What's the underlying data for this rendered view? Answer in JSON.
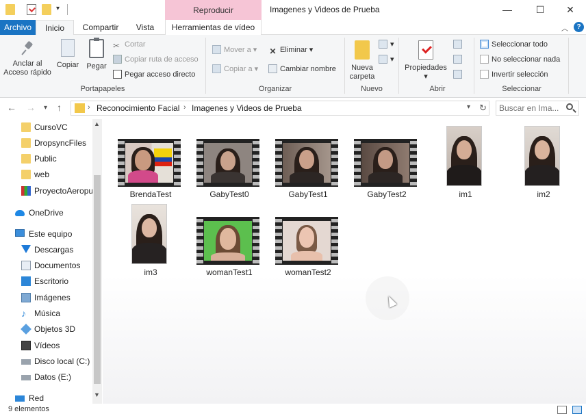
{
  "window": {
    "title": "Imagenes y Videos de Prueba",
    "context_tab_header": "Reproducir",
    "minimize": "—",
    "maximize": "☐",
    "close": "✕"
  },
  "tabs": {
    "archivo": "Archivo",
    "inicio": "Inicio",
    "compartir": "Compartir",
    "vista": "Vista",
    "herramientas": "Herramientas de vídeo"
  },
  "ribbon": {
    "portapapeles": {
      "label": "Portapapeles",
      "anclar": "Anclar al",
      "anclar2": "Acceso rápido",
      "copiar": "Copiar",
      "pegar": "Pegar",
      "cortar": "Cortar",
      "copiar_ruta": "Copiar ruta de acceso",
      "pegar_acceso": "Pegar acceso directo"
    },
    "organizar": {
      "label": "Organizar",
      "mover": "Mover a",
      "copiar_a": "Copiar a",
      "eliminar": "Eliminar",
      "cambiar_nombre": "Cambiar nombre"
    },
    "nuevo": {
      "label": "Nuevo",
      "nueva": "Nueva",
      "carpeta": "carpeta"
    },
    "abrir": {
      "label": "Abrir",
      "propiedades": "Propiedades"
    },
    "seleccionar": {
      "label": "Seleccionar",
      "todo": "Seleccionar todo",
      "nada": "No seleccionar nada",
      "invertir": "Invertir selección"
    }
  },
  "address": {
    "crumbs": [
      "Reconocimiento Facial",
      "Imagenes y Videos de Prueba"
    ],
    "search_placeholder": "Buscar en Ima..."
  },
  "nav": {
    "items": [
      "CursoVC",
      "DropsyncFiles",
      "Public",
      "web",
      "ProyectoAeropu",
      "OneDrive",
      "Este equipo",
      "Descargas",
      "Documentos",
      "Escritorio",
      "Imágenes",
      "Música",
      "Objetos 3D",
      "Vídeos",
      "Disco local (C:)",
      "Datos (E:)",
      "Red"
    ]
  },
  "files": [
    {
      "name": "BrendaTest",
      "kind": "video"
    },
    {
      "name": "GabyTest0",
      "kind": "video"
    },
    {
      "name": "GabyTest1",
      "kind": "video"
    },
    {
      "name": "GabyTest2",
      "kind": "video"
    },
    {
      "name": "im1",
      "kind": "image"
    },
    {
      "name": "im2",
      "kind": "image"
    },
    {
      "name": "im3",
      "kind": "image"
    },
    {
      "name": "womanTest1",
      "kind": "video"
    },
    {
      "name": "womanTest2",
      "kind": "video"
    }
  ],
  "status": {
    "count": "9 elementos"
  },
  "colors": {
    "accent": "#1a74c3",
    "context_tab": "#f6c5d6",
    "folder": "#f4d06a"
  }
}
